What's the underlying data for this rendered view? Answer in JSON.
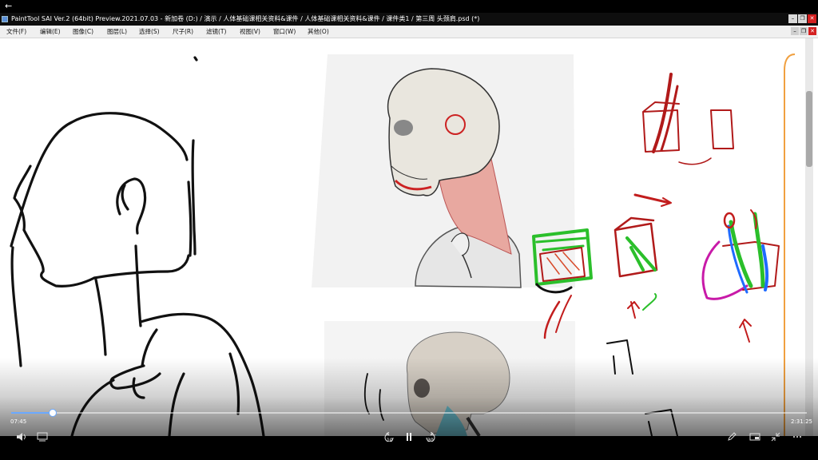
{
  "window": {
    "title": "PaintTool SAI Ver.2 (64bit) Preview.2021.07.03 - 新加卷 (D:) / 演示 / 人体基础课相关资料&课件 / 人体基础课相关资料&课件 / 课件类1 / 第三周 头颈肩.psd (*)"
  },
  "menu": {
    "items": [
      {
        "label": "文件(F)"
      },
      {
        "label": "编辑(E)"
      },
      {
        "label": "图像(C)"
      },
      {
        "label": "图层(L)"
      },
      {
        "label": "选择(S)"
      },
      {
        "label": "尺子(R)"
      },
      {
        "label": "滤镜(T)"
      },
      {
        "label": "视图(V)"
      },
      {
        "label": "窗口(W)"
      },
      {
        "label": "其他(O)"
      }
    ]
  },
  "player": {
    "current_time": "07:45",
    "total_time": "2:31:25",
    "progress": 0.052,
    "rewind_label": "10",
    "forward_label": "30"
  },
  "colors": {
    "accent": "#6aa9ff",
    "sketch_red": "#b11a1a",
    "sketch_green": "#2bbf2b",
    "sketch_blue": "#1f6bff",
    "sketch_magenta": "#c81aa8"
  }
}
